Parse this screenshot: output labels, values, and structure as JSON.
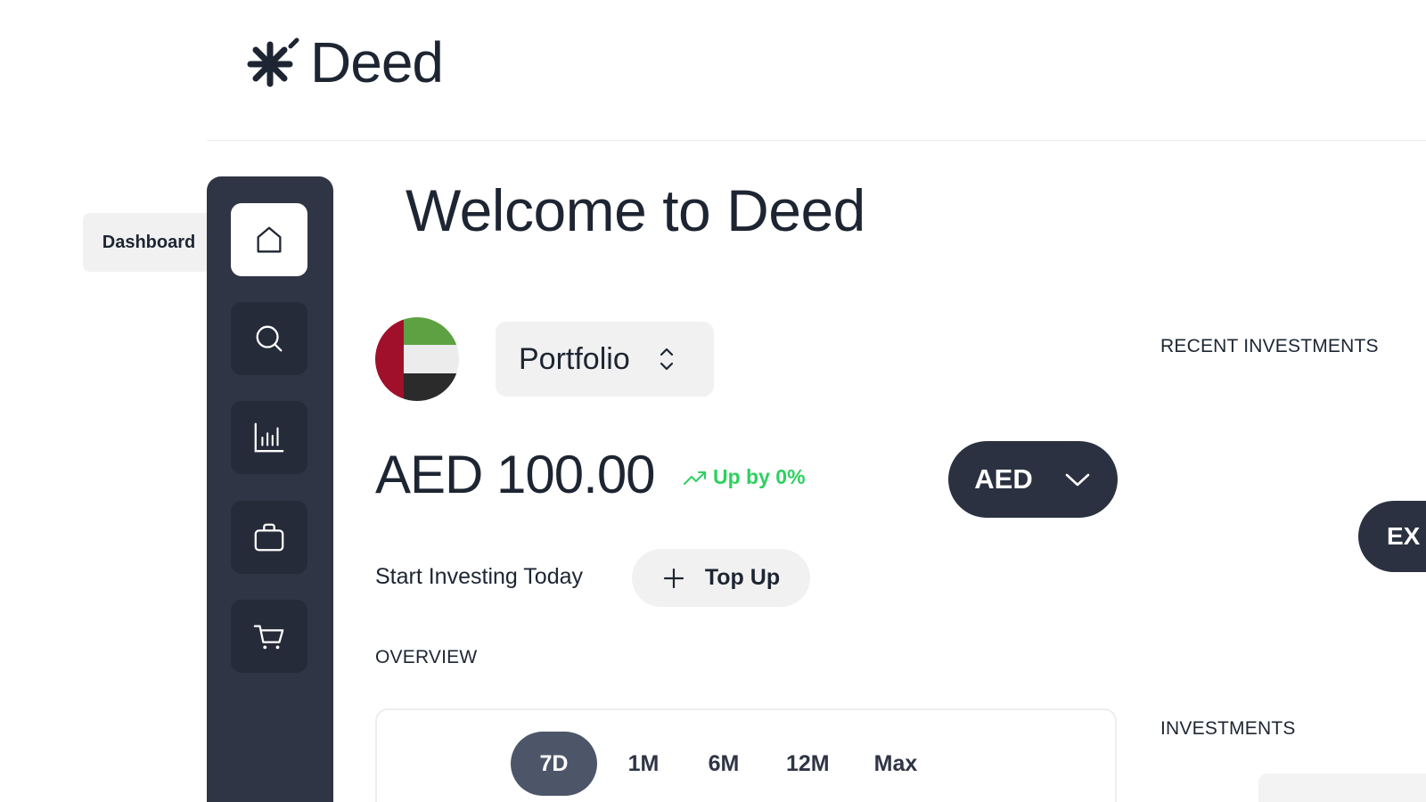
{
  "brand": {
    "name": "Deed",
    "logo_icon": "asterisk-spark-logo"
  },
  "tooltip": {
    "text": "Dashboard"
  },
  "sidebar": {
    "items": [
      {
        "id": "dashboard",
        "icon": "home-icon",
        "active": true
      },
      {
        "id": "search",
        "icon": "search-icon",
        "active": false
      },
      {
        "id": "analytics",
        "icon": "bar-chart-icon",
        "active": false
      },
      {
        "id": "portfolio",
        "icon": "briefcase-icon",
        "active": false
      },
      {
        "id": "cart",
        "icon": "cart-icon",
        "active": false
      }
    ]
  },
  "main": {
    "welcome": "Welcome to Deed",
    "portfolio_select": {
      "label": "Portfolio",
      "flag": "uae-flag"
    },
    "balance": "AED 100.00",
    "trend": "Up by 0%",
    "currency": "AED",
    "start_text": "Start Investing Today",
    "topup_label": "Top Up",
    "overview_label": "OVERVIEW",
    "ranges": [
      "7D",
      "1M",
      "6M",
      "12M",
      "Max"
    ],
    "active_range": "7D"
  },
  "right": {
    "recent_label": "RECENT INVESTMENTS",
    "investments_label": "INVESTMENTS",
    "explore_label": "EX"
  },
  "colors": {
    "sidebar": "#2f3545",
    "accent_dark": "#2b3140",
    "trend_green": "#2ed060",
    "chip_bg": "#f1f1f1"
  }
}
